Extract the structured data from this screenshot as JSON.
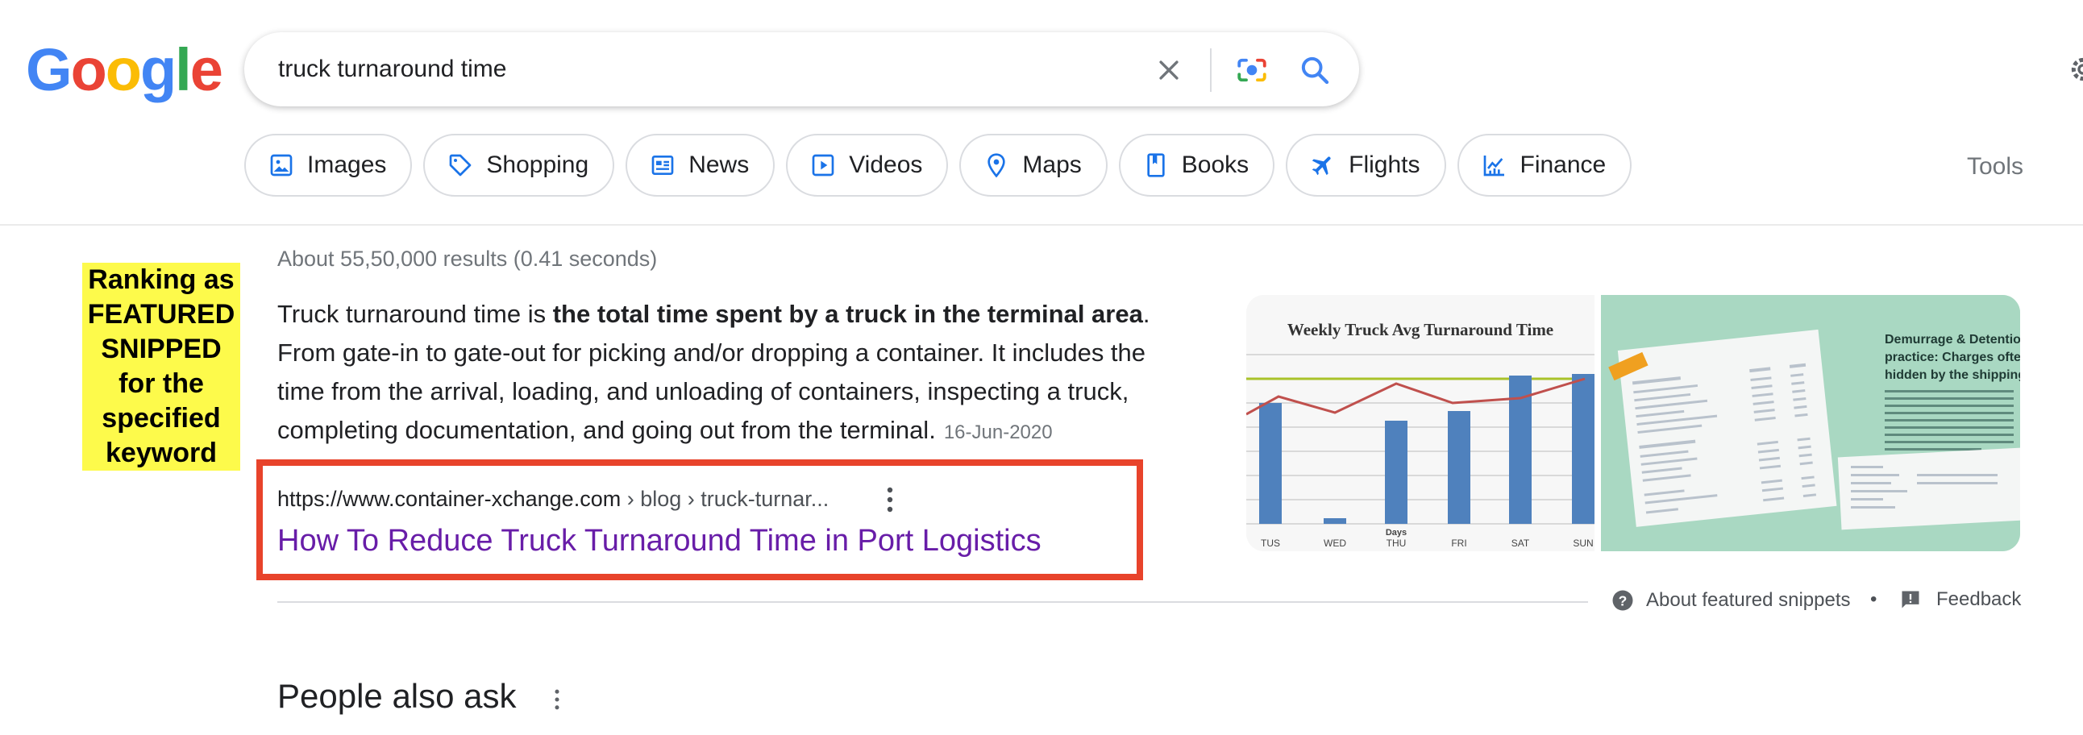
{
  "logo": {
    "text": "Google"
  },
  "search": {
    "query": "truck turnaround time"
  },
  "chips": [
    {
      "label": "Images",
      "icon": "image-icon"
    },
    {
      "label": "Shopping",
      "icon": "tag-icon"
    },
    {
      "label": "News",
      "icon": "news-icon"
    },
    {
      "label": "Videos",
      "icon": "play-icon"
    },
    {
      "label": "Maps",
      "icon": "map-pin-icon"
    },
    {
      "label": "Books",
      "icon": "book-icon"
    },
    {
      "label": "Flights",
      "icon": "airplane-icon"
    },
    {
      "label": "Finance",
      "icon": "finance-icon"
    }
  ],
  "tools": "Tools",
  "stats": "About 55,50,000 results (0.41 seconds)",
  "annotation": {
    "lines": [
      "Ranking as",
      "FEATURED",
      "SNIPPED",
      "for the",
      "specified",
      "keyword"
    ]
  },
  "snippet": {
    "prefix": "Truck turnaround time is ",
    "bold": "the total time spent by a truck in the terminal area",
    "rest": ". From gate-in to gate-out for picking and/or dropping a container. It includes the time from the arrival, loading, and unloading of containers, inspecting a truck, completing documentation, and going out from the terminal.",
    "date": "16-Jun-2020"
  },
  "result": {
    "domain": "https://www.container-xchange.com",
    "crumbs": " › blog › truck-turnar...",
    "title": "How To Reduce Truck Turnaround Time in Port Logistics"
  },
  "image1": {
    "title": "Weekly Truck Avg Turnaround Time",
    "days": [
      "TUS",
      "WED",
      "THU",
      "FRI",
      "SAT",
      "SUN"
    ],
    "xlabel": "Days"
  },
  "image2": {
    "heading_lines": [
      "Demurrage & Detention",
      "practice: Charges often",
      "hidden by the shipping"
    ]
  },
  "footer": {
    "about": "About featured snippets",
    "dot": "•",
    "feedback": "Feedback"
  },
  "paa": {
    "title": "People also ask"
  },
  "colors": {
    "accent": "#1a73e8",
    "visited": "#681da8",
    "highlight": "#fdfa4b",
    "red_box": "#e8432b"
  }
}
